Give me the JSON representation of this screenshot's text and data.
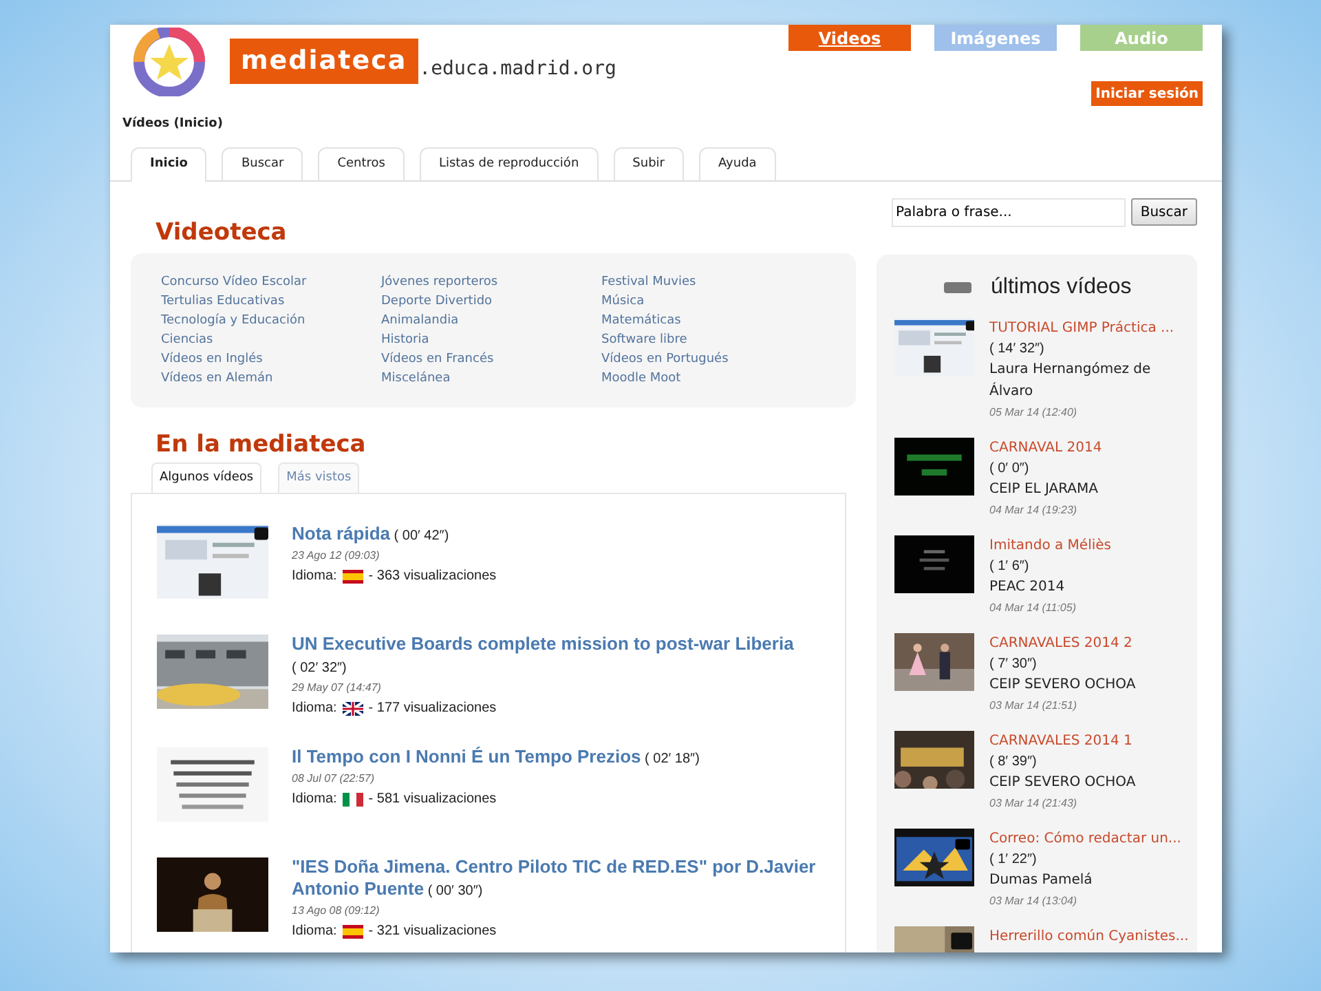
{
  "top_nav": [
    {
      "label": "Videos",
      "selected": true,
      "color": "#e8590c"
    },
    {
      "label": "Imágenes",
      "selected": false,
      "color": "#9ec0ea"
    },
    {
      "label": "Audio",
      "selected": false,
      "color": "#a8d08d"
    }
  ],
  "logo": {
    "name": "mediateca",
    "domain": ".educa.madrid.org"
  },
  "login_button": "Iniciar sesión",
  "breadcrumb": "Vídeos (Inicio)",
  "tabs": [
    {
      "label": "Inicio",
      "selected": true
    },
    {
      "label": "Buscar",
      "selected": false
    },
    {
      "label": "Centros",
      "selected": false
    },
    {
      "label": "Listas de reproducción",
      "selected": false
    },
    {
      "label": "Subir",
      "selected": false
    },
    {
      "label": "Ayuda",
      "selected": false
    }
  ],
  "videoteca": {
    "title": "Videoteca",
    "columns": [
      [
        "Concurso Vídeo Escolar",
        "Tertulias Educativas",
        "Tecnología y Educación",
        "Ciencias",
        "Vídeos en Inglés",
        "Vídeos en Alemán"
      ],
      [
        "Jóvenes reporteros",
        "Deporte Divertido",
        "Animalandia",
        "Historia",
        "Vídeos en Francés",
        "Miscelánea"
      ],
      [
        "Festival Muvies",
        "Música",
        "Matemáticas",
        "Software libre",
        "Vídeos en Portugués",
        "Moodle Moot"
      ]
    ]
  },
  "mediateca": {
    "title": "En la mediateca",
    "tabs": [
      {
        "label": "Algunos vídeos",
        "selected": true
      },
      {
        "label": "Más vistos",
        "selected": false
      }
    ],
    "videos": [
      {
        "title": "Nota rápida",
        "duration": "( 00′ 42″)",
        "date": "23 Ago 12 (09:03)",
        "language_label": "Idioma:",
        "flag": {
          "kind": "es"
        },
        "views": "- 363 visualizaciones"
      },
      {
        "title": "UN Executive Boards complete mission to post-war Liberia",
        "duration": "( 02′ 32″)",
        "date": "29 May 07 (14:47)",
        "language_label": "Idioma:",
        "flag": {
          "kind": "gb"
        },
        "views": "- 177 visualizaciones"
      },
      {
        "title": "Il Tempo con I Nonni É un Tempo Prezios",
        "duration": "( 02′ 18″)",
        "date": "08 Jul 07 (22:57)",
        "language_label": "Idioma:",
        "flag": {
          "kind": "it"
        },
        "views": "- 581 visualizaciones"
      },
      {
        "title": "\"IES Doña Jimena. Centro Piloto TIC de RED.ES\" por D.Javier Antonio Puente",
        "duration": "( 00′ 30″)",
        "date": "13 Ago 08 (09:12)",
        "language_label": "Idioma:",
        "flag": {
          "kind": "es"
        },
        "views": "- 321 visualizaciones"
      }
    ]
  },
  "search": {
    "placeholder": "Palabra o frase...",
    "button": "Buscar"
  },
  "latest": {
    "title": "últimos vídeos",
    "videos": [
      {
        "title": "TUTORIAL GIMP Práctica ...",
        "duration": "( 14′ 32″)",
        "author": "Laura Hernangómez de Álvaro",
        "date": "05 Mar 14 (12:40)"
      },
      {
        "title": "CARNAVAL 2014",
        "duration": "( 0′ 0″)",
        "author": "CEIP EL JARAMA",
        "date": "04 Mar 14 (19:23)"
      },
      {
        "title": "Imitando a Méliès",
        "duration": "( 1′ 6″)",
        "author": "PEAC 2014",
        "date": "04 Mar 14 (11:05)"
      },
      {
        "title": "CARNAVALES 2014 2",
        "duration": "( 7′ 30″)",
        "author": "CEIP SEVERO OCHOA",
        "date": "03 Mar 14 (21:51)"
      },
      {
        "title": "CARNAVALES 2014 1",
        "duration": "( 8′ 39″)",
        "author": "CEIP SEVERO OCHOA",
        "date": "03 Mar 14 (21:43)"
      },
      {
        "title": "Correo: Cómo redactar un...",
        "duration": "( 1′ 22″)",
        "author": "Dumas Pamelá",
        "date": "03 Mar 14 (13:04)"
      },
      {
        "title": "Herrerillo común Cyanistes..."
      }
    ]
  }
}
